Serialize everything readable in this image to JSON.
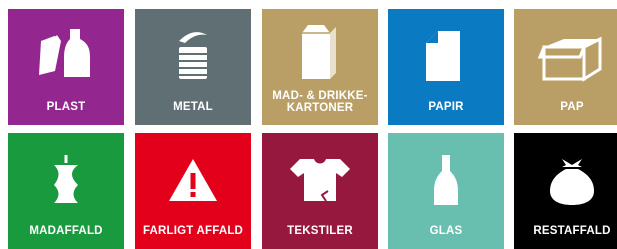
{
  "tiles": [
    {
      "label": "PLAST",
      "color": "#93278f",
      "icon": "plastic-bottle-bag-icon"
    },
    {
      "label": "METAL",
      "color": "#5f6f74",
      "icon": "tin-can-icon"
    },
    {
      "label_lines": [
        "MAD- & DRIKKE-",
        "KARTONER"
      ],
      "color": "#b99f66",
      "icon": "milk-carton-icon"
    },
    {
      "label": "PAPIR",
      "color": "#0a7ac2",
      "icon": "paper-sheet-icon"
    },
    {
      "label": "PAP",
      "color": "#b99f66",
      "icon": "cardboard-box-icon"
    },
    {
      "label": "MADAFFALD",
      "color": "#1a9a3f",
      "icon": "apple-core-icon"
    },
    {
      "label": "FARLIGT AFFALD",
      "color": "#e2001a",
      "icon": "warning-triangle-icon"
    },
    {
      "label": "TEKSTILER",
      "color": "#96183f",
      "icon": "torn-tshirt-icon"
    },
    {
      "label": "GLAS",
      "color": "#68bfaf",
      "icon": "glass-bottle-icon"
    },
    {
      "label": "RESTAFFALD",
      "color": "#000000",
      "icon": "trash-bag-icon"
    }
  ]
}
